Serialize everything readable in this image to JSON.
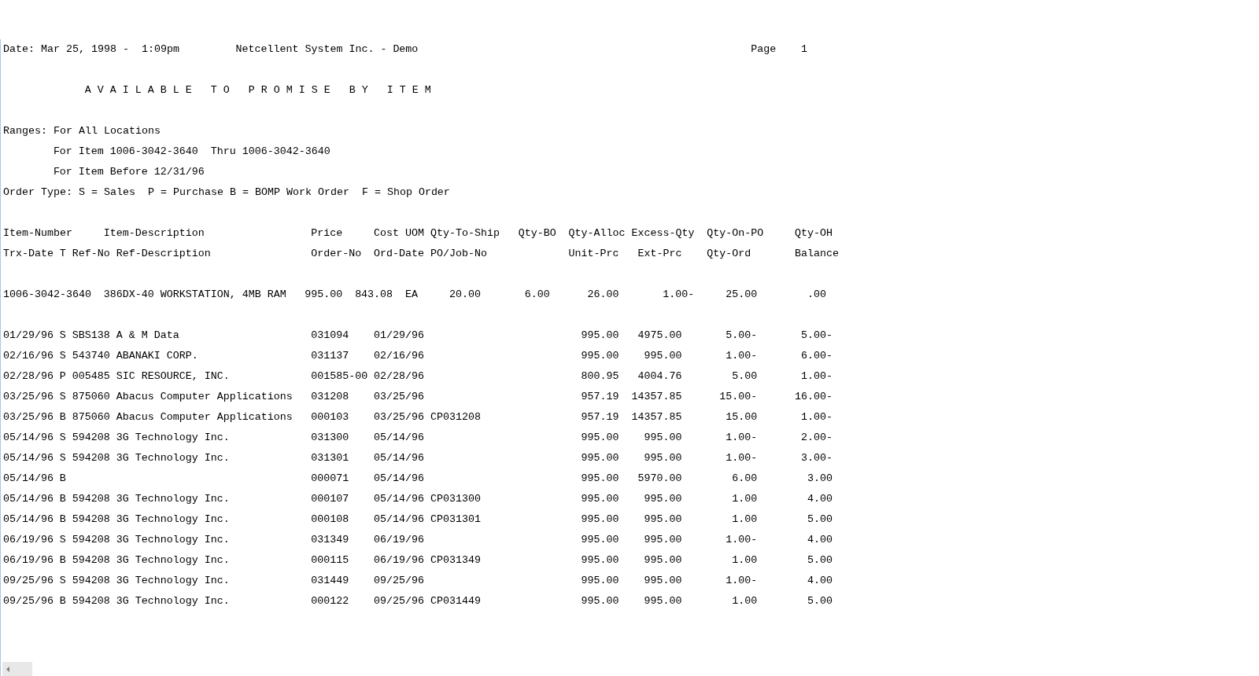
{
  "header": {
    "date": "Date: Mar 25, 1998 -  1:09pm",
    "company": "Netcellent System Inc. - Demo",
    "page_label": "Page",
    "page_number": "1"
  },
  "title": "A V A I L A B L E   T O   P R O M I S E   B Y   I T E M",
  "ranges": [
    "Ranges: For All Locations",
    "For Item 1006-3042-3640  Thru 1006-3042-3640",
    "For Item Before 12/31/96"
  ],
  "order_type": "Order Type: S = Sales  P = Purchase B = BOMP Work Order  F = Shop Order",
  "columns_1": [
    "Item-Number",
    "Item-Description",
    "Price",
    "Cost",
    "UOM",
    "Qty-To-Ship",
    "Qty-BO",
    "Qty-Alloc",
    "Excess-Qty",
    "Qty-On-PO",
    "Qty-OH"
  ],
  "columns_2": [
    "Trx-Date",
    "T",
    "Ref-No",
    "Ref-Description",
    "Order-No",
    "Ord-Date",
    "PO/Job-No",
    "Unit-Prc",
    "Ext-Prc",
    "Qty-Ord",
    "Balance"
  ],
  "item": {
    "item_number": "1006-3042-3640",
    "description": "386DX-40 WORKSTATION, 4MB RAM",
    "price": "995.00",
    "cost": "843.08",
    "uom": "EA",
    "qty_to_ship": "20.00",
    "qty_bo": "6.00",
    "qty_alloc": "26.00",
    "excess_qty": "1.00-",
    "qty_on_po": "25.00",
    "qty_oh": ".00"
  },
  "transactions": [
    {
      "trx_date": "01/29/96",
      "type": "S",
      "ref_no": "SBS138",
      "ref_description": "A & M Data",
      "order_no": "031094",
      "ord_date": "01/29/96",
      "unit_prc": "995.00",
      "ext_prc": "4975.00",
      "qty_ord": "5.00-",
      "balance": "5.00-"
    },
    {
      "trx_date": "02/16/96",
      "type": "S",
      "ref_no": "543740",
      "ref_description": "ABANAKI CORP.",
      "order_no": "031137",
      "ord_date": "02/16/96",
      "unit_prc": "995.00",
      "ext_prc": "995.00",
      "qty_ord": "1.00-",
      "balance": "6.00-"
    },
    {
      "trx_date": "02/28/96",
      "type": "P",
      "ref_no": "005485",
      "ref_description": "SIC RESOURCE, INC.",
      "order_no": "001585-00",
      "ord_date": "02/28/96",
      "unit_prc": "800.95",
      "ext_prc": "4004.76",
      "qty_ord": "5.00",
      "balance": "1.00-"
    },
    {
      "trx_date": "03/25/96",
      "type": "S",
      "ref_no": "875060",
      "ref_description": "Abacus Computer Applications",
      "order_no": "031208",
      "ord_date": "03/25/96",
      "unit_prc": "957.19",
      "ext_prc": "14357.85",
      "qty_ord": "15.00-",
      "balance": "16.00-"
    },
    {
      "trx_date": "03/25/96",
      "type": "B",
      "ref_no": "875060",
      "ref_description": "Abacus Computer Applications",
      "order_no": "000103",
      "ord_date": "03/25/96",
      "po_job_no": "CP031208",
      "unit_prc": "957.19",
      "ext_prc": "14357.85",
      "qty_ord": "15.00",
      "balance": "1.00-"
    },
    {
      "trx_date": "05/14/96",
      "type": "S",
      "ref_no": "594208",
      "ref_description": "3G Technology Inc.",
      "order_no": "031300",
      "ord_date": "05/14/96",
      "unit_prc": "995.00",
      "ext_prc": "995.00",
      "qty_ord": "1.00-",
      "balance": "2.00-"
    },
    {
      "trx_date": "05/14/96",
      "type": "S",
      "ref_no": "594208",
      "ref_description": "3G Technology Inc.",
      "order_no": "031301",
      "ord_date": "05/14/96",
      "unit_prc": "995.00",
      "ext_prc": "995.00",
      "qty_ord": "1.00-",
      "balance": "3.00-"
    },
    {
      "trx_date": "05/14/96",
      "type": "B",
      "order_no": "000071",
      "ord_date": "05/14/96",
      "unit_prc": "995.00",
      "ext_prc": "5970.00",
      "qty_ord": "6.00",
      "balance": "3.00"
    },
    {
      "trx_date": "05/14/96",
      "type": "B",
      "ref_no": "594208",
      "ref_description": "3G Technology Inc.",
      "order_no": "000107",
      "ord_date": "05/14/96",
      "po_job_no": "CP031300",
      "unit_prc": "995.00",
      "ext_prc": "995.00",
      "qty_ord": "1.00",
      "balance": "4.00"
    },
    {
      "trx_date": "05/14/96",
      "type": "B",
      "ref_no": "594208",
      "ref_description": "3G Technology Inc.",
      "order_no": "000108",
      "ord_date": "05/14/96",
      "po_job_no": "CP031301",
      "unit_prc": "995.00",
      "ext_prc": "995.00",
      "qty_ord": "1.00",
      "balance": "5.00"
    },
    {
      "trx_date": "06/19/96",
      "type": "S",
      "ref_no": "594208",
      "ref_description": "3G Technology Inc.",
      "order_no": "031349",
      "ord_date": "06/19/96",
      "unit_prc": "995.00",
      "ext_prc": "995.00",
      "qty_ord": "1.00-",
      "balance": "4.00"
    },
    {
      "trx_date": "06/19/96",
      "type": "B",
      "ref_no": "594208",
      "ref_description": "3G Technology Inc.",
      "order_no": "000115",
      "ord_date": "06/19/96",
      "po_job_no": "CP031349",
      "unit_prc": "995.00",
      "ext_prc": "995.00",
      "qty_ord": "1.00",
      "balance": "5.00"
    },
    {
      "trx_date": "09/25/96",
      "type": "S",
      "ref_no": "594208",
      "ref_description": "3G Technology Inc.",
      "order_no": "031449",
      "ord_date": "09/25/96",
      "unit_prc": "995.00",
      "ext_prc": "995.00",
      "qty_ord": "1.00-",
      "balance": "4.00"
    },
    {
      "trx_date": "09/25/96",
      "type": "B",
      "ref_no": "594208",
      "ref_description": "3G Technology Inc.",
      "order_no": "000122",
      "ord_date": "09/25/96",
      "po_job_no": "CP031449",
      "unit_prc": "995.00",
      "ext_prc": "995.00",
      "qty_ord": "1.00",
      "balance": "5.00"
    }
  ]
}
